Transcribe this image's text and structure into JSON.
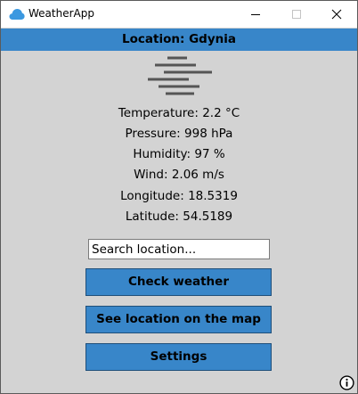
{
  "window": {
    "title": "WeatherApp",
    "icon": "cloud-icon",
    "controls": [
      "minimize-icon",
      "maximize-icon",
      "close-icon"
    ]
  },
  "location_bar": {
    "text": "Location: Gdynia"
  },
  "weather": {
    "icon": "fog-icon",
    "temperature": "Temperature: 2.2 °C",
    "pressure": "Pressure: 998 hPa",
    "humidity": "Humidity: 97 %",
    "wind": "Wind: 2.06 m/s",
    "longitude": "Longitude: 18.5319",
    "latitude": "Latitude: 54.5189"
  },
  "search": {
    "placeholder": "Search location..."
  },
  "buttons": {
    "check_weather": "Check weather",
    "see_on_map": "See location on the map",
    "settings": "Settings"
  },
  "info_icon": "info-icon",
  "colors": {
    "accent": "#3886c9",
    "background": "#d3d3d3",
    "titlebar": "#ffffff",
    "app_icon": "#3b98e0"
  }
}
